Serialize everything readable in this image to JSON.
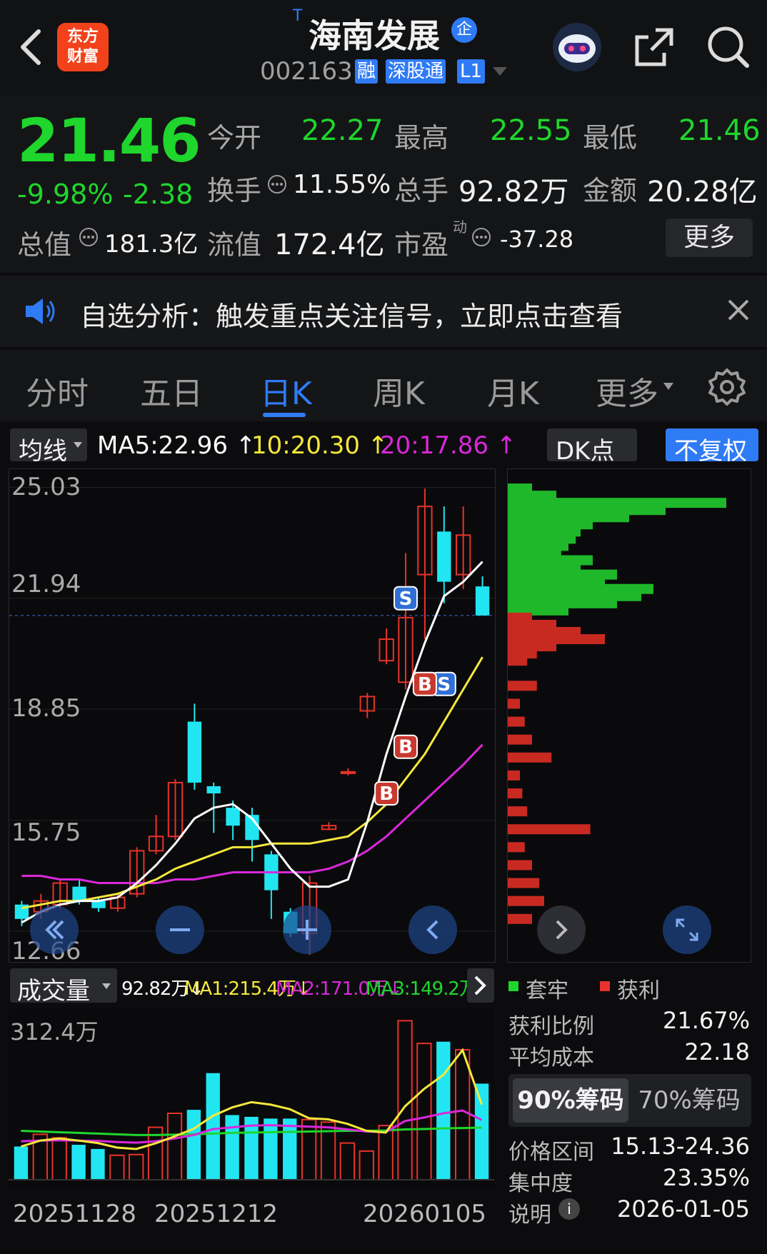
{
  "header": {
    "logo_text": "东方财富",
    "superscript": "T",
    "title": "海南发展",
    "title_badge": "企",
    "code": "002163",
    "tags": [
      "融",
      "深股通",
      "L1"
    ],
    "icons": [
      "back-icon",
      "robot-icon",
      "share-icon",
      "search-icon"
    ]
  },
  "quote": {
    "price": "21.46",
    "change_pct": "-9.98%",
    "change": "-2.38",
    "open_label": "今开",
    "open": "22.27",
    "high_label": "最高",
    "high": "22.55",
    "low_label": "最低",
    "low": "21.46",
    "turnover_label": "换手",
    "turnover": "11.55%",
    "volume_label": "总手",
    "volume": "92.82万",
    "amount_label": "金额",
    "amount": "20.28亿",
    "mktcap_label": "总值",
    "mktcap": "181.3亿",
    "float_label": "流值",
    "float": "172.4亿",
    "pe_label": "市盈",
    "pe_sup": "动",
    "pe": "-37.28",
    "more_button": "更多"
  },
  "banner": {
    "text": "自选分析：触发重点关注信号，立即点击查看"
  },
  "tabs": [
    {
      "label": "分时"
    },
    {
      "label": "五日"
    },
    {
      "label": "日K",
      "active": true
    },
    {
      "label": "周K"
    },
    {
      "label": "月K"
    },
    {
      "label": "更多"
    }
  ],
  "ma_bar": {
    "dropdown": "均线",
    "ma5": "MA5:22.96 ↑",
    "ma10": "10:20.30 ↑",
    "ma20": "20:17.86 ↑",
    "dk_button": "DK点",
    "adjust_button": "不复权"
  },
  "colors": {
    "up": "#e8322a",
    "down": "#21e6f2",
    "green": "#1fd62c",
    "ma5": "#ffffff",
    "ma10": "#f5e83c",
    "ma20": "#d928d9",
    "accent": "#2f7bf5"
  },
  "kline": {
    "y_ticks": [
      "25.03",
      "21.94",
      "18.85",
      "15.75",
      "12.66"
    ],
    "ylim": [
      12.66,
      25.03
    ],
    "markers": [
      {
        "label": "S",
        "type": "sell"
      },
      {
        "label": "S",
        "type": "sell"
      },
      {
        "label": "B",
        "type": "buy"
      },
      {
        "label": "B",
        "type": "buy"
      },
      {
        "label": "B",
        "type": "buy"
      }
    ]
  },
  "volume_bar": {
    "dropdown": "成交量",
    "vol": "92.82万↓",
    "ma1": "MA1:215.4万↓",
    "ma2": "MA2:171.0万↓",
    "ma3": "MA3:149.2万↑",
    "y_max": "312.4万"
  },
  "dates": [
    "20251128",
    "20251212",
    "20260105"
  ],
  "chips": {
    "legend_trapped": "套牢",
    "legend_profit": "获利",
    "rows1": [
      {
        "label": "获利比例",
        "value": "21.67%"
      },
      {
        "label": "平均成本",
        "value": "22.18"
      }
    ],
    "tab90": "90%筹码",
    "tab70": "70%筹码",
    "rows2": [
      {
        "label": "价格区间",
        "value": "15.13-24.36"
      },
      {
        "label": "集中度",
        "value": "23.35%"
      },
      {
        "label": "说明",
        "value": "2026-01-05"
      }
    ]
  },
  "chart_data": {
    "type": "candlestick",
    "candles": [
      {
        "o": 13.4,
        "c": 13.0,
        "h": 13.5,
        "l": 12.8
      },
      {
        "o": 13.2,
        "c": 13.5,
        "h": 13.7,
        "l": 13.0
      },
      {
        "o": 13.4,
        "c": 14.0,
        "h": 14.1,
        "l": 13.3
      },
      {
        "o": 13.9,
        "c": 13.5,
        "h": 14.1,
        "l": 13.4
      },
      {
        "o": 13.5,
        "c": 13.3,
        "h": 13.6,
        "l": 13.2
      },
      {
        "o": 13.3,
        "c": 13.6,
        "h": 13.7,
        "l": 13.2
      },
      {
        "o": 13.7,
        "c": 14.9,
        "h": 15.0,
        "l": 13.6
      },
      {
        "o": 14.9,
        "c": 15.3,
        "h": 15.9,
        "l": 14.8
      },
      {
        "o": 15.3,
        "c": 16.8,
        "h": 16.9,
        "l": 15.2
      },
      {
        "o": 18.5,
        "c": 16.8,
        "h": 19.0,
        "l": 16.6
      },
      {
        "o": 16.7,
        "c": 16.5,
        "h": 16.8,
        "l": 15.4
      },
      {
        "o": 16.1,
        "c": 15.6,
        "h": 16.3,
        "l": 15.2
      },
      {
        "o": 15.9,
        "c": 15.2,
        "h": 16.1,
        "l": 14.6
      },
      {
        "o": 14.8,
        "c": 13.8,
        "h": 14.9,
        "l": 13.0
      },
      {
        "o": 13.2,
        "c": 12.6,
        "h": 13.3,
        "l": 12.5
      },
      {
        "o": 12.6,
        "c": 14.0,
        "h": 14.2,
        "l": 12.0
      },
      {
        "o": 15.5,
        "c": 15.6,
        "h": 15.7,
        "l": 15.5
      },
      {
        "o": 17.1,
        "c": 17.1,
        "h": 17.2,
        "l": 17.0
      },
      {
        "o": 18.8,
        "c": 19.2,
        "h": 19.3,
        "l": 18.6
      },
      {
        "o": 20.2,
        "c": 20.8,
        "h": 21.1,
        "l": 20.1
      },
      {
        "o": 19.6,
        "c": 21.4,
        "h": 23.2,
        "l": 19.4
      },
      {
        "o": 22.6,
        "c": 24.5,
        "h": 25.0,
        "l": 20.8
      },
      {
        "o": 23.8,
        "c": 22.4,
        "h": 24.5,
        "l": 21.8
      },
      {
        "o": 22.6,
        "c": 23.7,
        "h": 24.5,
        "l": 22.2
      },
      {
        "o": 22.27,
        "c": 21.46,
        "h": 22.55,
        "l": 21.46
      }
    ],
    "ma5": [
      12.9,
      13.2,
      13.4,
      13.5,
      13.5,
      13.6,
      14.0,
      14.5,
      15.1,
      15.8,
      16.1,
      16.2,
      15.8,
      15.1,
      14.4,
      13.9,
      13.9,
      14.1,
      15.7,
      17.6,
      19.2,
      20.7,
      22.0,
      22.4,
      22.96
    ],
    "ma10": [
      13.3,
      13.4,
      13.5,
      13.5,
      13.6,
      13.7,
      13.9,
      14.1,
      14.4,
      14.6,
      14.8,
      15.0,
      15.0,
      15.1,
      15.1,
      15.1,
      15.2,
      15.3,
      15.7,
      16.2,
      16.9,
      17.6,
      18.5,
      19.4,
      20.3
    ],
    "ma20": [
      14.2,
      14.2,
      14.1,
      14.1,
      14.0,
      14.0,
      14.0,
      14.0,
      14.1,
      14.1,
      14.2,
      14.3,
      14.3,
      14.3,
      14.3,
      14.3,
      14.4,
      14.6,
      14.9,
      15.3,
      15.8,
      16.3,
      16.8,
      17.3,
      17.86
    ],
    "volumes": [
      95,
      130,
      120,
      100,
      88,
      70,
      72,
      150,
      190,
      200,
      305,
      185,
      180,
      175,
      175,
      172,
      165,
      105,
      82,
      155,
      455,
      390,
      395,
      372,
      275
    ],
    "vol_ma1": [
      95,
      112,
      118,
      112,
      105,
      92,
      88,
      104,
      124,
      146,
      183,
      207,
      222,
      215,
      202,
      176,
      173,
      160,
      140,
      135,
      210,
      260,
      300,
      371,
      215.4
    ],
    "vol_ma2": [
      110,
      112,
      113,
      112,
      111,
      108,
      106,
      110,
      118,
      128,
      145,
      150,
      155,
      156,
      154,
      152,
      150,
      144,
      138,
      136,
      168,
      178,
      190,
      198,
      171.0
    ],
    "vol_ma3": [
      140,
      138,
      136,
      134,
      132,
      130,
      128,
      128,
      129,
      130,
      132,
      134,
      135,
      136,
      137,
      138,
      139,
      140,
      140,
      141,
      144,
      145,
      147,
      148,
      149.2
    ],
    "vol_max": 312.4,
    "chip_profile": [
      {
        "price": 25.0,
        "pct": 0.1,
        "profit": false
      },
      {
        "price": 24.8,
        "pct": 0.2,
        "profit": false
      },
      {
        "price": 24.6,
        "pct": 0.9,
        "profit": false
      },
      {
        "price": 24.4,
        "pct": 0.65,
        "profit": false
      },
      {
        "price": 24.2,
        "pct": 0.5,
        "profit": false
      },
      {
        "price": 24.0,
        "pct": 0.35,
        "profit": false
      },
      {
        "price": 23.8,
        "pct": 0.3,
        "profit": false
      },
      {
        "price": 23.6,
        "pct": 0.28,
        "profit": false
      },
      {
        "price": 23.4,
        "pct": 0.25,
        "profit": false
      },
      {
        "price": 23.2,
        "pct": 0.22,
        "profit": false
      },
      {
        "price": 23.0,
        "pct": 0.35,
        "profit": false
      },
      {
        "price": 22.8,
        "pct": 0.3,
        "profit": false
      },
      {
        "price": 22.6,
        "pct": 0.45,
        "profit": false
      },
      {
        "price": 22.4,
        "pct": 0.4,
        "profit": false
      },
      {
        "price": 22.2,
        "pct": 0.6,
        "profit": false
      },
      {
        "price": 22.0,
        "pct": 0.55,
        "profit": false
      },
      {
        "price": 21.8,
        "pct": 0.45,
        "profit": false
      },
      {
        "price": 21.6,
        "pct": 0.25,
        "profit": false
      },
      {
        "price": 21.4,
        "pct": 0.1,
        "profit": true
      },
      {
        "price": 21.2,
        "pct": 0.2,
        "profit": true
      },
      {
        "price": 21.0,
        "pct": 0.3,
        "profit": true
      },
      {
        "price": 20.8,
        "pct": 0.4,
        "profit": true
      },
      {
        "price": 20.6,
        "pct": 0.2,
        "profit": true
      },
      {
        "price": 20.4,
        "pct": 0.12,
        "profit": true
      },
      {
        "price": 20.2,
        "pct": 0.08,
        "profit": true
      },
      {
        "price": 19.5,
        "pct": 0.12,
        "profit": true
      },
      {
        "price": 19.0,
        "pct": 0.05,
        "profit": true
      },
      {
        "price": 18.5,
        "pct": 0.07,
        "profit": true
      },
      {
        "price": 18.0,
        "pct": 0.1,
        "profit": true
      },
      {
        "price": 17.5,
        "pct": 0.18,
        "profit": true
      },
      {
        "price": 17.0,
        "pct": 0.05,
        "profit": true
      },
      {
        "price": 16.5,
        "pct": 0.06,
        "profit": true
      },
      {
        "price": 16.0,
        "pct": 0.08,
        "profit": true
      },
      {
        "price": 15.5,
        "pct": 0.34,
        "profit": true
      },
      {
        "price": 15.0,
        "pct": 0.07,
        "profit": true
      },
      {
        "price": 14.5,
        "pct": 0.1,
        "profit": true
      },
      {
        "price": 14.0,
        "pct": 0.13,
        "profit": true
      },
      {
        "price": 13.5,
        "pct": 0.15,
        "profit": true
      },
      {
        "price": 13.0,
        "pct": 0.1,
        "profit": true
      }
    ]
  }
}
